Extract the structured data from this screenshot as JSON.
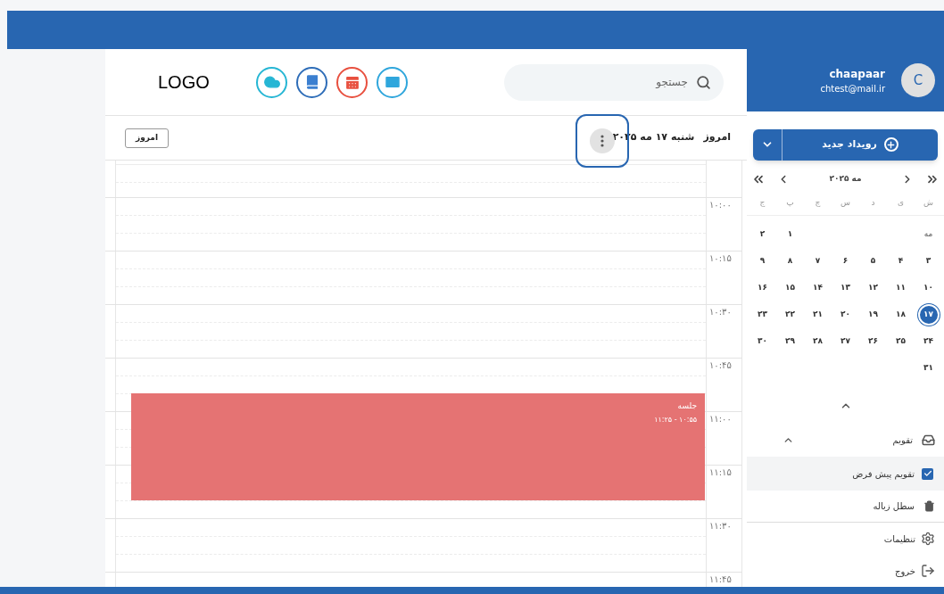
{
  "header": {
    "logo": "LOGO",
    "apps": [
      {
        "kind": "cloud"
      },
      {
        "kind": "book"
      },
      {
        "kind": "calendar"
      },
      {
        "kind": "mail"
      }
    ],
    "search": {
      "placeholder": "جستجو"
    }
  },
  "user": {
    "avatar_letter": "C",
    "name": "chaapaar",
    "email": "chtest@mail.ir"
  },
  "toolbar": {
    "today_button": "امروز",
    "today_label": "امروز",
    "date": "شنبه ۱۷ مه ۲۰۲۵"
  },
  "schedule": {
    "slots": [
      "۱۰:۰۰",
      "۱۰:۱۵",
      "۱۰:۳۰",
      "۱۰:۴۵",
      "۱۱:۰۰",
      "۱۱:۱۵",
      "۱۱:۳۰",
      "۱۱:۴۵"
    ],
    "events": [
      {
        "title": "جلسه",
        "time": "۱۰:۵۵ - ۱۱:۲۵",
        "color": "#e57373"
      }
    ]
  },
  "new_event_button": {
    "label": "رویداد جدید"
  },
  "mini_calendar": {
    "month": "مه ۲۰۲۵",
    "weekdays": [
      "ش",
      "ی",
      "د",
      "س",
      "چ",
      "پ",
      "ج"
    ],
    "weeks": [
      {
        "label": "مه",
        "days": [
          {
            "day": "۱",
            "selected": false
          },
          {
            "day": "۲",
            "selected": false
          }
        ]
      },
      {
        "days": [
          {
            "day": "۳",
            "selected": false
          },
          {
            "day": "۴",
            "selected": false
          },
          {
            "day": "۵",
            "selected": false
          },
          {
            "day": "۶",
            "selected": false
          },
          {
            "day": "۷",
            "selected": false
          },
          {
            "day": "۸",
            "selected": false
          },
          {
            "day": "۹",
            "selected": false
          }
        ]
      },
      {
        "days": [
          {
            "day": "۱۰",
            "selected": false
          },
          {
            "day": "۱۱",
            "selected": false
          },
          {
            "day": "۱۲",
            "selected": false
          },
          {
            "day": "۱۳",
            "selected": false
          },
          {
            "day": "۱۴",
            "selected": false
          },
          {
            "day": "۱۵",
            "selected": false
          },
          {
            "day": "۱۶",
            "selected": false
          }
        ]
      },
      {
        "days": [
          {
            "day": "۱۷",
            "selected": true
          },
          {
            "day": "۱۸",
            "selected": false
          },
          {
            "day": "۱۹",
            "selected": false
          },
          {
            "day": "۲۰",
            "selected": false
          },
          {
            "day": "۲۱",
            "selected": false
          },
          {
            "day": "۲۲",
            "selected": false
          },
          {
            "day": "۲۳",
            "selected": false
          }
        ]
      },
      {
        "days": [
          {
            "day": "۲۴",
            "selected": false
          },
          {
            "day": "۲۵",
            "selected": false
          },
          {
            "day": "۲۶",
            "selected": false
          },
          {
            "day": "۲۷",
            "selected": false
          },
          {
            "day": "۲۸",
            "selected": false
          },
          {
            "day": "۲۹",
            "selected": false
          },
          {
            "day": "۳۰",
            "selected": false
          }
        ]
      },
      {
        "days": [
          {
            "day": "۳۱",
            "selected": false
          }
        ]
      }
    ]
  },
  "sidebar": {
    "calendars": {
      "label": "تقویم",
      "expanded": true,
      "children": [
        {
          "label": "تقویم پیش فرض",
          "checked": true,
          "selected": true
        }
      ]
    },
    "items": [
      {
        "kind": "trash",
        "label": "سطل زباله"
      }
    ],
    "menu": [
      {
        "kind": "settings",
        "label": "تنظیمات"
      },
      {
        "kind": "logout",
        "label": "خروج"
      }
    ]
  }
}
